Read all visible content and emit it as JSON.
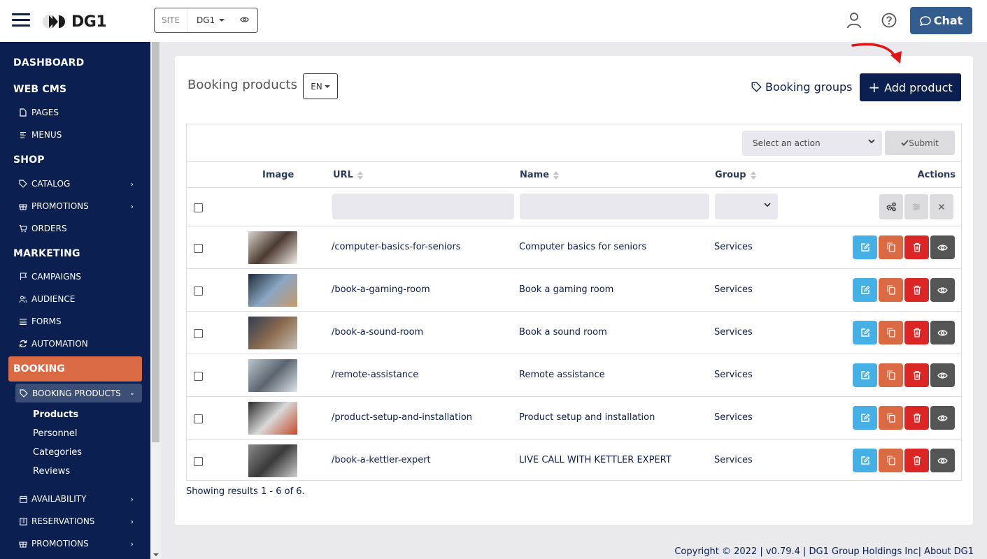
{
  "header": {
    "logo_text": "DG1",
    "site_label": "SITE",
    "site_value": "DG1",
    "chat_label": "Chat"
  },
  "sidebar": {
    "sections": [
      {
        "label": "DASHBOARD"
      },
      {
        "label": "WEB CMS",
        "items": [
          {
            "label": "PAGES",
            "icon": "file-icon"
          },
          {
            "label": "MENUS",
            "icon": "menu-lines-icon"
          }
        ]
      },
      {
        "label": "SHOP",
        "items": [
          {
            "label": "CATALOG",
            "icon": "tag-icon",
            "expandable": true
          },
          {
            "label": "PROMOTIONS",
            "icon": "gift-icon",
            "expandable": true
          },
          {
            "label": "ORDERS",
            "icon": "cart-icon"
          }
        ]
      },
      {
        "label": "MARKETING",
        "items": [
          {
            "label": "CAMPAIGNS",
            "icon": "flag-icon"
          },
          {
            "label": "AUDIENCE",
            "icon": "users-icon"
          },
          {
            "label": "FORMS",
            "icon": "list-icon"
          },
          {
            "label": "AUTOMATION",
            "icon": "refresh-icon"
          }
        ]
      },
      {
        "label": "BOOKING",
        "active": true,
        "items": [
          {
            "label": "BOOKING PRODUCTS",
            "icon": "tag-icon",
            "expanded": true,
            "children": [
              {
                "label": "Products",
                "active": true
              },
              {
                "label": "Personnel"
              },
              {
                "label": "Categories"
              },
              {
                "label": "Reviews"
              }
            ]
          },
          {
            "label": "AVAILABILITY",
            "icon": "calendar-icon",
            "expandable": true
          },
          {
            "label": "RESERVATIONS",
            "icon": "calendar-grid-icon",
            "expandable": true
          },
          {
            "label": "PROMOTIONS",
            "icon": "gift-icon",
            "expandable": true
          }
        ]
      }
    ]
  },
  "page": {
    "title": "Booking products",
    "language": "EN",
    "groups_link": "Booking groups",
    "add_button": "Add product",
    "bulk_action_placeholder": "Select an action",
    "submit_label": "Submit",
    "showing_text": "Showing results 1 - 6 of 6."
  },
  "table": {
    "columns": {
      "image": "Image",
      "url": "URL",
      "name": "Name",
      "group": "Group",
      "actions": "Actions"
    },
    "rows": [
      {
        "url": "/computer-basics-for-seniors",
        "name": "Computer basics for seniors",
        "group": "Services",
        "thumb_colors": [
          "#d9d4cc",
          "#4b3a30",
          "#f2efe9"
        ]
      },
      {
        "url": "/book-a-gaming-room",
        "name": "Book a gaming room",
        "group": "Services",
        "thumb_colors": [
          "#1e2b3a",
          "#8aa6c2",
          "#c79a6a"
        ]
      },
      {
        "url": "/book-a-sound-room",
        "name": "Book a sound room",
        "group": "Services",
        "thumb_colors": [
          "#2f3e55",
          "#8a6a4e",
          "#c9c1b8"
        ]
      },
      {
        "url": "/remote-assistance",
        "name": "Remote assistance",
        "group": "Services",
        "thumb_colors": [
          "#b9c4cc",
          "#5a6570",
          "#dfe4e8"
        ]
      },
      {
        "url": "/product-setup-and-installation",
        "name": "Product setup and installation",
        "group": "Services",
        "thumb_colors": [
          "#2a2a2a",
          "#d8d8d8",
          "#c44a2a"
        ]
      },
      {
        "url": "/book-a-kettler-expert",
        "name": "LIVE CALL WITH KETTLER EXPERT",
        "group": "Services",
        "thumb_colors": [
          "#8a8a8a",
          "#3a3a3a",
          "#cfcfcf"
        ]
      }
    ],
    "action_colors": {
      "edit": "#45b0e5",
      "copy": "#d96a43",
      "delete": "#dc2626",
      "view": "#555555"
    }
  },
  "footer": {
    "text": "Copyright © 2022 | v0.79.4 | DG1 Group Holdings Inc| About DG1"
  }
}
